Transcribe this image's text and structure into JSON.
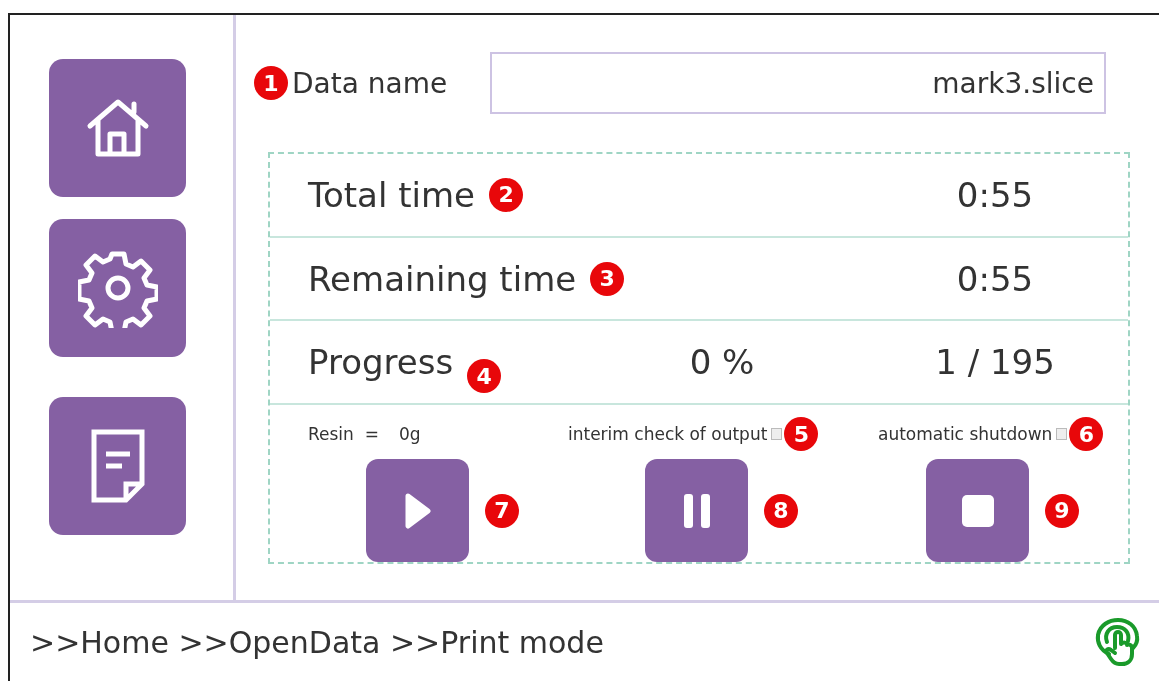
{
  "sidebar": {
    "buttons": [
      {
        "kind": "home"
      },
      {
        "kind": "settings"
      },
      {
        "kind": "document"
      }
    ]
  },
  "data_name": {
    "label": "Data name",
    "value": "mark3.slice",
    "callout": "1"
  },
  "rows": [
    {
      "label": "Total time",
      "callout": "2",
      "values": [
        "0:55"
      ]
    },
    {
      "label": "Remaining time",
      "callout": "3",
      "values": [
        "0:55"
      ]
    },
    {
      "label": "Progress",
      "callout": "4",
      "values": [
        "0 %",
        "1 / 195"
      ]
    }
  ],
  "resin": {
    "label": "Resin  =",
    "value": "0g"
  },
  "options": [
    {
      "label": "interim check of output",
      "checked": false,
      "callout": "5"
    },
    {
      "label": "automatic shutdown",
      "checked": false,
      "callout": "6"
    }
  ],
  "controls": [
    {
      "kind": "play",
      "callout": "7"
    },
    {
      "kind": "pause",
      "callout": "8"
    },
    {
      "kind": "stop",
      "callout": "9"
    }
  ],
  "footer": {
    "breadcrumb": ">>Home >>OpenData >>Print mode"
  }
}
